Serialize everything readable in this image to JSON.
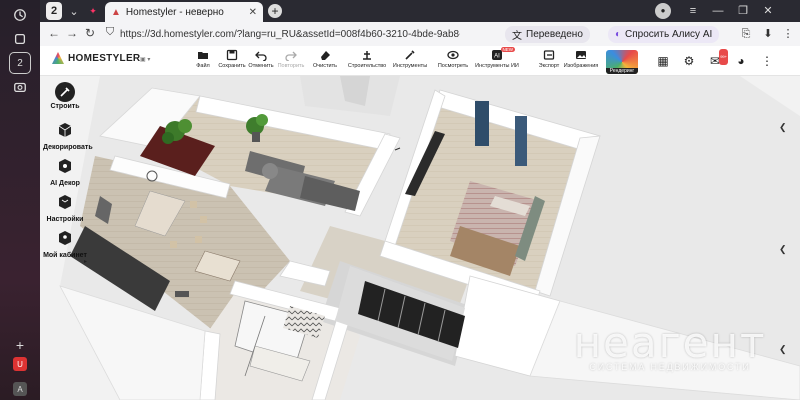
{
  "browser": {
    "tab_title": "Homestyler - неверно",
    "tab_count": "2",
    "url": "https://3d.homestyler.com/?lang=ru_RU&assetId=008f4b60-3210-4bde-9ab8-...",
    "translate_label": "Переведено",
    "alice_label": "Спросить Алису AI"
  },
  "app": {
    "logo_text": "HOMESTYLER",
    "toolbar": [
      {
        "label": "Файл",
        "icon": "folder-icon"
      },
      {
        "label": "Сохранить",
        "icon": "save-icon"
      },
      {
        "label": "Отменить",
        "icon": "undo-icon"
      },
      {
        "label": "Повторить",
        "icon": "redo-icon"
      },
      {
        "label": "Очистить",
        "icon": "eraser-icon"
      },
      {
        "label": "Строительство",
        "icon": "build-icon"
      },
      {
        "label": "Инструменты",
        "icon": "tools-icon"
      },
      {
        "label": "Посмотреть",
        "icon": "eye-icon"
      },
      {
        "label": "Инструменты ИИ",
        "icon": "ai-icon",
        "badge": "NEW"
      },
      {
        "label": "Экспорт",
        "icon": "export-icon"
      },
      {
        "label": "Изображения",
        "icon": "image-icon"
      }
    ],
    "render_label": "Рендеринг",
    "notif_badge": "99+"
  },
  "side_panel": [
    {
      "label": "Строить",
      "icon": "build-wrench-icon",
      "active": true
    },
    {
      "label": "Декорировать",
      "icon": "box-icon"
    },
    {
      "label": "AI Декор",
      "icon": "ai-cube-icon"
    },
    {
      "label": "Настройки",
      "icon": "settings-icon"
    },
    {
      "label": "Мой кабинет",
      "icon": "cabinet-icon"
    }
  ],
  "watermark": {
    "main": "неагент",
    "sub": "СИСТЕМА НЕДВИЖИМОСТИ"
  }
}
